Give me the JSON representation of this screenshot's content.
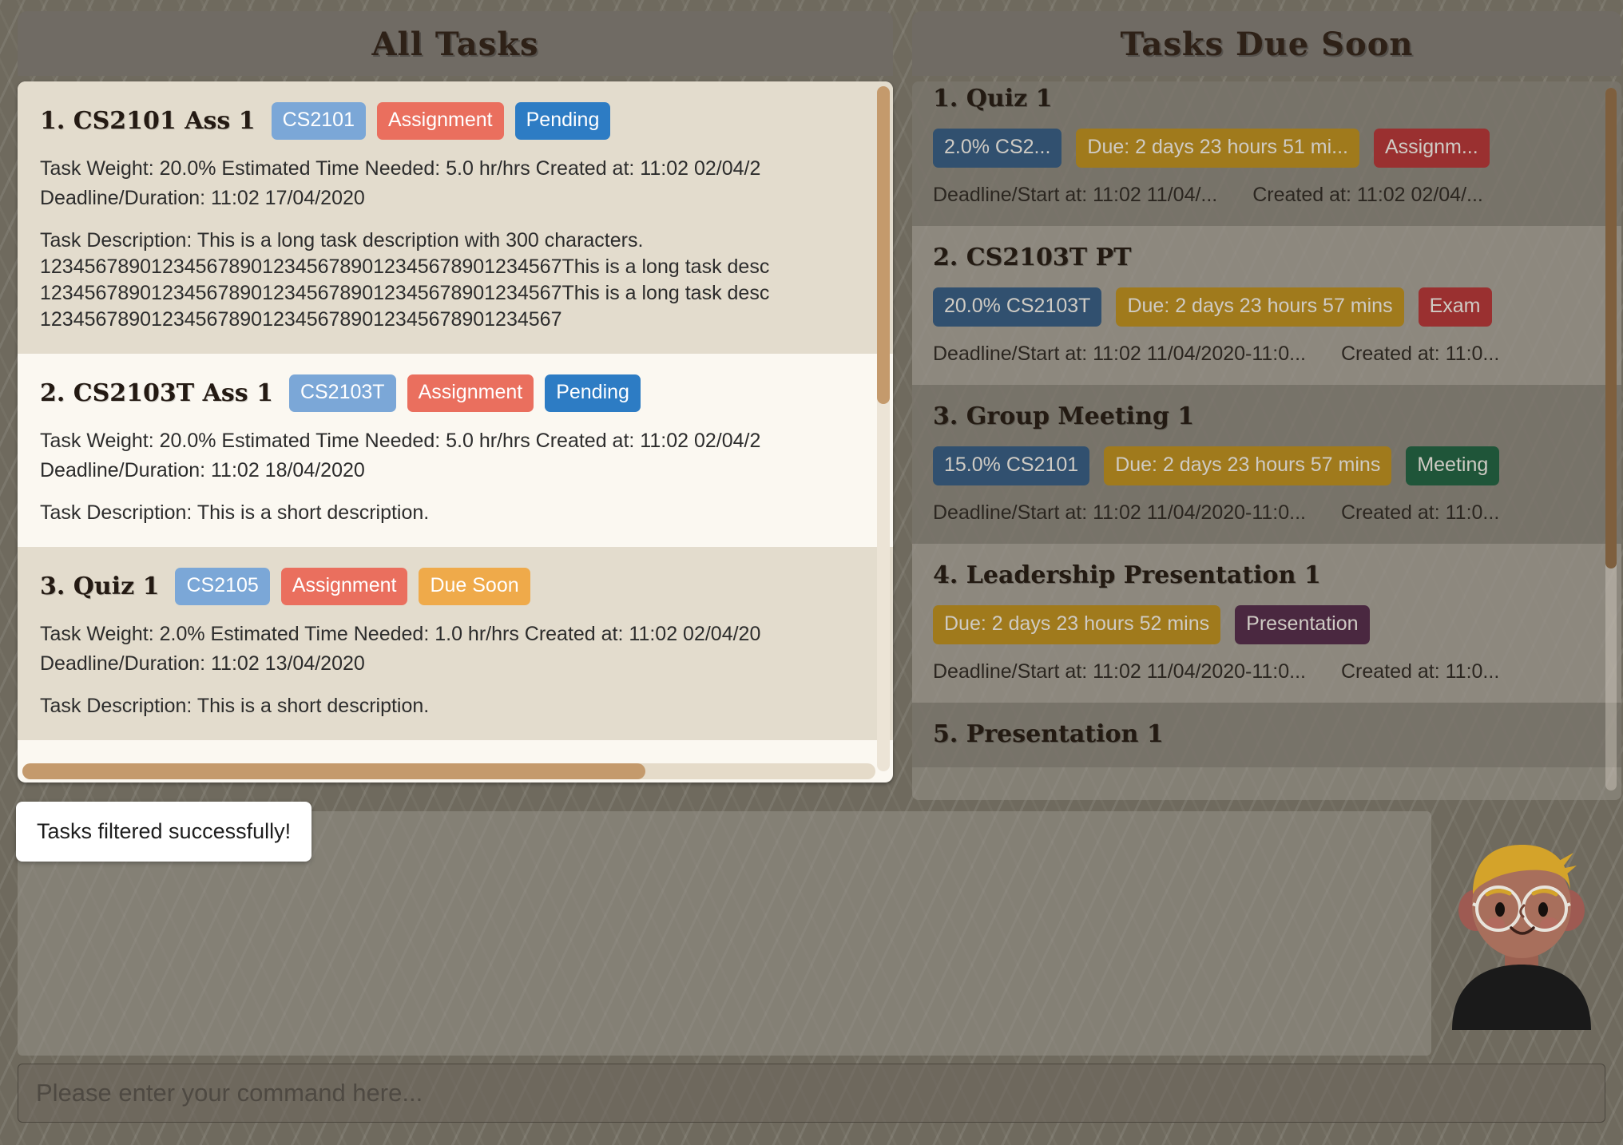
{
  "all_tasks": {
    "title": "All Tasks",
    "tasks": [
      {
        "index": "1.",
        "name": "CS2101 Ass 1",
        "chips": [
          {
            "label": "CS2101",
            "color": "#7ba7d7"
          },
          {
            "label": "Assignment",
            "color": "#ea6f5e"
          },
          {
            "label": "Pending",
            "color": "#2d7cc4"
          }
        ],
        "meta": "Task Weight: 20.0%   Estimated Time Needed: 5.0 hr/hrs   Created at: 11:02 02/04/2",
        "deadline": "Deadline/Duration: 11:02 17/04/2020",
        "description_lines": [
          "Task Description: This is a long task description with 300 characters.",
          "12345678901234567890123456789012345678901234567This is a long task desc",
          "12345678901234567890123456789012345678901234567This is a long task desc",
          "12345678901234567890123456789012345678901234567"
        ]
      },
      {
        "index": "2.",
        "name": "CS2103T Ass 1",
        "chips": [
          {
            "label": "CS2103T",
            "color": "#7ba7d7"
          },
          {
            "label": "Assignment",
            "color": "#ea6f5e"
          },
          {
            "label": "Pending",
            "color": "#2d7cc4"
          }
        ],
        "meta": "Task Weight: 20.0%   Estimated Time Needed: 5.0 hr/hrs   Created at: 11:02 02/04/2",
        "deadline": "Deadline/Duration: 11:02 18/04/2020",
        "description_lines": [
          "Task Description: This is a short description."
        ]
      },
      {
        "index": "3.",
        "name": "Quiz 1",
        "chips": [
          {
            "label": "CS2105",
            "color": "#7ba7d7"
          },
          {
            "label": "Assignment",
            "color": "#ea6f5e"
          },
          {
            "label": "Due Soon",
            "color": "#efaa4a"
          }
        ],
        "meta": "Task Weight: 2.0%   Estimated Time Needed: 1.0 hr/hrs   Created at: 11:02 02/04/20",
        "deadline": "Deadline/Duration: 11:02 13/04/2020",
        "description_lines": [
          "Task Description: This is a short description."
        ]
      }
    ]
  },
  "due_soon": {
    "title": "Tasks Due Soon",
    "tasks": [
      {
        "index": "1.",
        "name": "Quiz 1",
        "chips": [
          {
            "label": "2.0% CS2...",
            "color": "#31506f"
          },
          {
            "label": "Due: 2 days 23 hours 51 mi...",
            "color": "#a07a1c"
          },
          {
            "label": "Assignm...",
            "color": "#9a3030"
          }
        ],
        "deadline": "Deadline/Start at: 11:02 11/04/...",
        "created": "Created at: 11:02 02/04/..."
      },
      {
        "index": "2.",
        "name": "CS2103T PT",
        "chips": [
          {
            "label": "20.0% CS2103T",
            "color": "#31506f"
          },
          {
            "label": "Due: 2 days 23 hours 57 mins",
            "color": "#a07a1c"
          },
          {
            "label": "Exam",
            "color": "#9a3030"
          }
        ],
        "deadline": "Deadline/Start at: 11:02 11/04/2020-11:0...",
        "created": "Created at: 11:0..."
      },
      {
        "index": "3.",
        "name": "Group Meeting 1",
        "chips": [
          {
            "label": "15.0% CS2101",
            "color": "#31506f"
          },
          {
            "label": "Due: 2 days 23 hours 57 mins",
            "color": "#a07a1c"
          },
          {
            "label": "Meeting",
            "color": "#1f5539"
          }
        ],
        "deadline": "Deadline/Start at: 11:02 11/04/2020-11:0...",
        "created": "Created at: 11:0..."
      },
      {
        "index": "4.",
        "name": "Leadership Presentation 1",
        "chips": [
          {
            "label": "Due: 2 days 23 hours 52 mins",
            "color": "#a07a1c"
          },
          {
            "label": "Presentation",
            "color": "#4a2840"
          }
        ],
        "deadline": "Deadline/Start at: 11:02 11/04/2020-11:0...",
        "created": "Created at: 11:0..."
      },
      {
        "index": "5.",
        "name": "Presentation 1",
        "chips": [],
        "deadline": "",
        "created": ""
      }
    ]
  },
  "message_area": {
    "toast": "Tasks filtered successfully!"
  },
  "command_bar": {
    "value": "",
    "placeholder": "Please enter your command here..."
  },
  "avatar": {
    "name": "user-avatar",
    "hair_color": "#d4a32a",
    "skin_color": "#a86f5c",
    "shirt_color": "#1a1a1a"
  }
}
